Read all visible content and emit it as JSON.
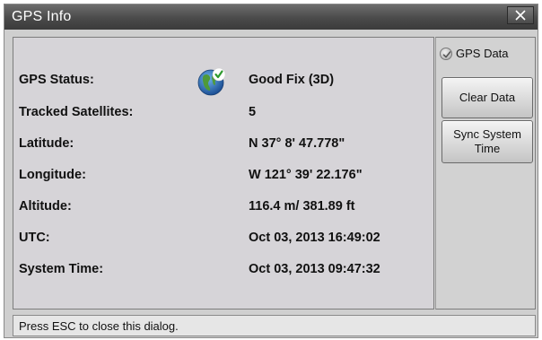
{
  "window": {
    "title": "GPS Info",
    "close_icon": "close-icon"
  },
  "info": {
    "rows": [
      {
        "label": "GPS Status:",
        "value": "Good Fix (3D)",
        "icon": "globe-check-icon"
      },
      {
        "label": "Tracked Satellites:",
        "value": "5"
      },
      {
        "label": "Latitude:",
        "value": "N 37° 8' 47.778\""
      },
      {
        "label": "Longitude:",
        "value": "W 121° 39' 22.176\""
      },
      {
        "label": "Altitude:",
        "value": "116.4 m/ 381.89 ft"
      },
      {
        "label": "UTC:",
        "value": "Oct 03, 2013 16:49:02"
      },
      {
        "label": "System Time:",
        "value": "Oct 03, 2013 09:47:32"
      }
    ]
  },
  "side_panel": {
    "gps_data_label": "GPS Data",
    "gps_data_checked": true,
    "clear_button_label": "Clear Data",
    "sync_button_label": "Sync System Time"
  },
  "status_bar": {
    "message": "Press ESC to close this dialog."
  },
  "colors": {
    "titlebar": "#4a4a4a",
    "panel_bg": "#d6d4d8",
    "window_bg": "#cfcfcf"
  }
}
